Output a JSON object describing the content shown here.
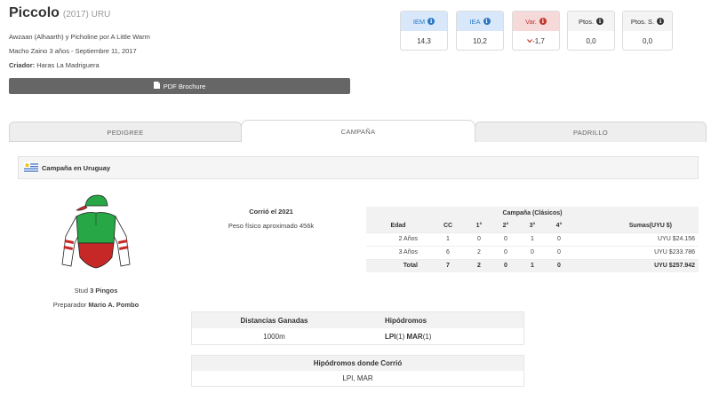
{
  "horse": {
    "name": "Piccolo",
    "year_country": "(2017) URU",
    "pedigree_line": "Awzaan (Alhaarth) y Picholine por A Little Warm",
    "description_line": "Macho Zaino 3 años - Septiembre 11, 2017",
    "breeder_label": "Criador:",
    "breeder": "Haras La Madriguera"
  },
  "pdf_button": {
    "label": "PDF Brochure",
    "icon": "pdf-file-icon"
  },
  "stats": [
    {
      "label": "IEM",
      "value": "14,3",
      "style": "blue"
    },
    {
      "label": "IEA",
      "value": "10,2",
      "style": "blue"
    },
    {
      "label": "Var.",
      "value": "-1,7",
      "style": "red"
    },
    {
      "label": "Ptos.",
      "value": "0,0",
      "style": "plain"
    },
    {
      "label": "Ptos. S.",
      "value": "0,0",
      "style": "plain"
    }
  ],
  "tabs": [
    {
      "label": "PEDIGREE",
      "active": false
    },
    {
      "label": "CAMPAÑA",
      "active": true
    },
    {
      "label": "PADRILLO",
      "active": false
    }
  ],
  "section": {
    "title": "Campaña en Uruguay",
    "flag": "uruguay-flag-icon"
  },
  "silks": {
    "colors": {
      "body": "#27a745",
      "lower": "#c62828",
      "cap": "#27a745",
      "sleeves_stripe": "#c62828"
    }
  },
  "stud": {
    "prefix": "Stud",
    "name": "3 Pingos"
  },
  "trainer": {
    "prefix": "Preparador",
    "name": "Mario A. Pombo"
  },
  "ran": {
    "text": "Corrió el 2021",
    "weight": "Peso físico aproximado 456k"
  },
  "campaign": {
    "title": "Campaña (Clásicos)",
    "headers": [
      "Edad",
      "CC",
      "1°",
      "2°",
      "3°",
      "4°",
      "Sumas(UYU $)"
    ],
    "rows": [
      [
        "2 Años",
        "1",
        "0",
        "0",
        "1",
        "0",
        "UYU $24.156"
      ],
      [
        "3 Años",
        "6",
        "2",
        "0",
        "0",
        "0",
        "UYU $233.786"
      ]
    ],
    "total": [
      "Total",
      "7",
      "2",
      "0",
      "1",
      "0",
      "UYU $257.942"
    ]
  },
  "distances": {
    "headers": [
      "Distancias Ganadas",
      "Hipódromos"
    ],
    "row": {
      "distance": "1000m",
      "track1": "LPI",
      "count1": "(1)",
      "track2": "MAR",
      "count2": "(1)"
    }
  },
  "tracks_ran": {
    "header": "Hipódromos donde Corrió",
    "value": "LPI, MAR"
  }
}
